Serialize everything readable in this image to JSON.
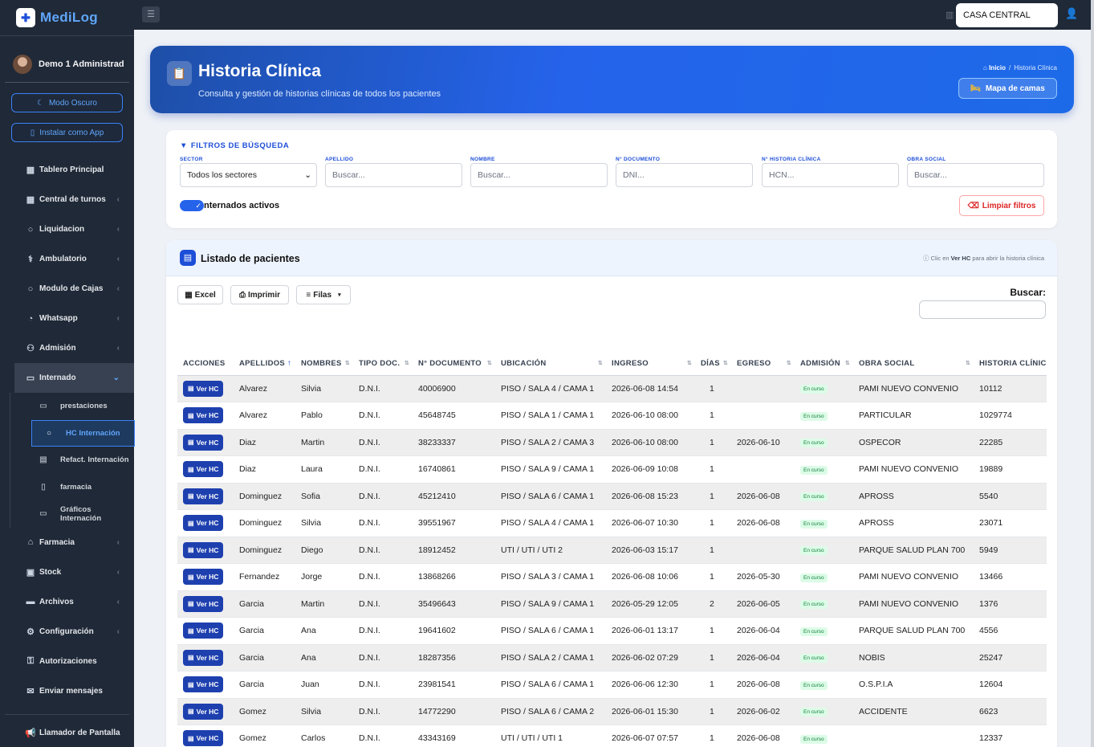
{
  "app": {
    "name": "MediLog"
  },
  "user": {
    "name": "Demo 1 Administrad"
  },
  "sidebar": {
    "dark_mode_label": "Modo Oscuro",
    "install_label": "Instalar como App",
    "items": [
      {
        "label": "Tablero Principal",
        "icon": "dashboard-icon",
        "chevron": false
      },
      {
        "label": "Central de turnos",
        "icon": "calendar-icon",
        "chevron": true
      },
      {
        "label": "Liquidacion",
        "icon": "circle-icon",
        "chevron": true
      },
      {
        "label": "Ambulatorio",
        "icon": "stethoscope-icon",
        "chevron": true
      },
      {
        "label": "Modulo de Cajas",
        "icon": "circle-icon",
        "chevron": true
      },
      {
        "label": "Whatsapp",
        "icon": "whatsapp-icon",
        "chevron": true
      },
      {
        "label": "Admisión",
        "icon": "users-cog-icon",
        "chevron": true
      }
    ],
    "active_item": {
      "label": "Internado",
      "icon": "bed-icon"
    },
    "subitems": [
      {
        "label": "prestaciones",
        "icon": "bed-icon",
        "active": false
      },
      {
        "label": "HC Internación",
        "icon": "circle-icon",
        "active": true
      },
      {
        "label": "Refact. Internación",
        "icon": "invoice-icon",
        "active": false
      },
      {
        "label": "farmacia",
        "icon": "pill-bottle-icon",
        "active": false
      },
      {
        "label": "Gráficos Internación",
        "icon": "bed-icon",
        "active": false
      }
    ],
    "items_after": [
      {
        "label": "Farmacia",
        "icon": "clinic-icon",
        "chevron": true
      },
      {
        "label": "Stock",
        "icon": "boxes-icon",
        "chevron": true
      },
      {
        "label": "Archivos",
        "icon": "folder-icon",
        "chevron": true
      },
      {
        "label": "Configuración",
        "icon": "gear-icon",
        "chevron": true
      },
      {
        "label": "Autorizaciones",
        "icon": "key-icon",
        "chevron": false
      },
      {
        "label": "Enviar mensajes",
        "icon": "envelope-icon",
        "chevron": false
      }
    ],
    "footer_item": {
      "label": "Llamador de Pantalla",
      "icon": "megaphone-icon"
    }
  },
  "topbar": {
    "sede": "CASA CENTRAL"
  },
  "hero": {
    "title": "Historia Clínica",
    "subtitle": "Consulta y gestión de historias clínicas de todos los pacientes",
    "breadcrumb_home": "Inicio",
    "breadcrumb_current": "Historia Clínica",
    "map_button": "Mapa de camas"
  },
  "filters": {
    "title": "FILTROS DE BÚSQUEDA",
    "fields": [
      {
        "label": "SECTOR",
        "value": "Todos los sectores",
        "type": "select"
      },
      {
        "label": "APELLIDO",
        "placeholder": "Buscar..."
      },
      {
        "label": "NOMBRE",
        "placeholder": "Buscar..."
      },
      {
        "label": "N° DOCUMENTO",
        "placeholder": "DNI..."
      },
      {
        "label": "N° HISTORIA CLÍNICA",
        "placeholder": "HCN..."
      },
      {
        "label": "OBRA SOCIAL",
        "placeholder": "Buscar..."
      }
    ],
    "toggle_label": "nternados activos",
    "toggle_on": true,
    "clear_button": "Limpiar filtros"
  },
  "listing": {
    "title": "Listado de pacientes",
    "hint_prefix": "Clic en",
    "hint_bold": "Ver HC",
    "hint_suffix": "para abrir la historia clínica",
    "buttons": {
      "excel": "Excel",
      "print": "Imprimir",
      "rows": "Filas"
    },
    "search_label": "Buscar:",
    "columns": [
      "ACCIONES",
      "APELLIDOS",
      "NOMBRES",
      "TIPO DOC.",
      "N° DOCUMENTO",
      "UBICACIÓN",
      "INGRESO",
      "DÍAS",
      "EGRESO",
      "ADMISIÓN",
      "OBRA SOCIAL",
      "HISTORIA CLÍNIC"
    ],
    "action_label": "Ver HC",
    "rows": [
      {
        "apellido": "Alvarez",
        "nombre": "Silvia",
        "tipo": "D.N.I.",
        "doc": "40006900",
        "ubicacion": "PISO / SALA 4 / CAMA 1",
        "ingreso": "2026-06-08 14:54",
        "dias": "1",
        "egreso": "",
        "admision": "En curso",
        "obra": "PAMI NUEVO CONVENIO",
        "hc": "10112"
      },
      {
        "apellido": "Alvarez",
        "nombre": "Pablo",
        "tipo": "D.N.I.",
        "doc": "45648745",
        "ubicacion": "PISO / SALA 1 / CAMA 1",
        "ingreso": "2026-06-10 08:00",
        "dias": "1",
        "egreso": "",
        "admision": "En curso",
        "obra": "PARTICULAR",
        "hc": "1029774"
      },
      {
        "apellido": "Diaz",
        "nombre": "Martin",
        "tipo": "D.N.I.",
        "doc": "38233337",
        "ubicacion": "PISO / SALA 2 / CAMA 3",
        "ingreso": "2026-06-10 08:00",
        "dias": "1",
        "egreso": "2026-06-10",
        "admision": "En curso",
        "obra": "OSPECOR",
        "hc": "22285"
      },
      {
        "apellido": "Diaz",
        "nombre": "Laura",
        "tipo": "D.N.I.",
        "doc": "16740861",
        "ubicacion": "PISO / SALA 9 / CAMA 1",
        "ingreso": "2026-06-09 10:08",
        "dias": "1",
        "egreso": "",
        "admision": "En curso",
        "obra": "PAMI NUEVO CONVENIO",
        "hc": "19889"
      },
      {
        "apellido": "Dominguez",
        "nombre": "Sofia",
        "tipo": "D.N.I.",
        "doc": "45212410",
        "ubicacion": "PISO / SALA 6 / CAMA 1",
        "ingreso": "2026-06-08 15:23",
        "dias": "1",
        "egreso": "2026-06-08",
        "admision": "En curso",
        "obra": "APROSS",
        "hc": "5540"
      },
      {
        "apellido": "Dominguez",
        "nombre": "Silvia",
        "tipo": "D.N.I.",
        "doc": "39551967",
        "ubicacion": "PISO / SALA 4 / CAMA 1",
        "ingreso": "2026-06-07 10:30",
        "dias": "1",
        "egreso": "2026-06-08",
        "admision": "En curso",
        "obra": "APROSS",
        "hc": "23071"
      },
      {
        "apellido": "Dominguez",
        "nombre": "Diego",
        "tipo": "D.N.I.",
        "doc": "18912452",
        "ubicacion": "UTI / UTI / UTI 2",
        "ingreso": "2026-06-03 15:17",
        "dias": "1",
        "egreso": "",
        "admision": "En curso",
        "obra": "PARQUE SALUD PLAN 700",
        "hc": "5949"
      },
      {
        "apellido": "Fernandez",
        "nombre": "Jorge",
        "tipo": "D.N.I.",
        "doc": "13868266",
        "ubicacion": "PISO / SALA 3 / CAMA 1",
        "ingreso": "2026-06-08 10:06",
        "dias": "1",
        "egreso": "2026-05-30",
        "admision": "En curso",
        "obra": "PAMI NUEVO CONVENIO",
        "hc": "13466"
      },
      {
        "apellido": "Garcia",
        "nombre": "Martin",
        "tipo": "D.N.I.",
        "doc": "35496643",
        "ubicacion": "PISO / SALA 9 / CAMA 1",
        "ingreso": "2026-05-29 12:05",
        "dias": "2",
        "egreso": "2026-06-05",
        "admision": "En curso",
        "obra": "PAMI NUEVO CONVENIO",
        "hc": "1376"
      },
      {
        "apellido": "Garcia",
        "nombre": "Ana",
        "tipo": "D.N.I.",
        "doc": "19641602",
        "ubicacion": "PISO / SALA 6 / CAMA 1",
        "ingreso": "2026-06-01 13:17",
        "dias": "1",
        "egreso": "2026-06-04",
        "admision": "En curso",
        "obra": "PARQUE SALUD PLAN 700",
        "hc": "4556"
      },
      {
        "apellido": "Garcia",
        "nombre": "Ana",
        "tipo": "D.N.I.",
        "doc": "18287356",
        "ubicacion": "PISO / SALA 2 / CAMA 1",
        "ingreso": "2026-06-02 07:29",
        "dias": "1",
        "egreso": "2026-06-04",
        "admision": "En curso",
        "obra": "NOBIS",
        "hc": "25247"
      },
      {
        "apellido": "Garcia",
        "nombre": "Juan",
        "tipo": "D.N.I.",
        "doc": "23981541",
        "ubicacion": "PISO / SALA 6 / CAMA 1",
        "ingreso": "2026-06-06 12:30",
        "dias": "1",
        "egreso": "2026-06-08",
        "admision": "En curso",
        "obra": "O.S.P.I.A",
        "hc": "12604"
      },
      {
        "apellido": "Gomez",
        "nombre": "Silvia",
        "tipo": "D.N.I.",
        "doc": "14772290",
        "ubicacion": "PISO / SALA 6 / CAMA 2",
        "ingreso": "2026-06-01 15:30",
        "dias": "1",
        "egreso": "2026-06-02",
        "admision": "En curso",
        "obra": "ACCIDENTE",
        "hc": "6623"
      },
      {
        "apellido": "Gomez",
        "nombre": "Carlos",
        "tipo": "D.N.I.",
        "doc": "43343169",
        "ubicacion": "UTI / UTI / UTI 1",
        "ingreso": "2026-06-07 07:57",
        "dias": "1",
        "egreso": "2026-06-08",
        "admision": "En curso",
        "obra": "",
        "hc": "12337"
      }
    ]
  }
}
